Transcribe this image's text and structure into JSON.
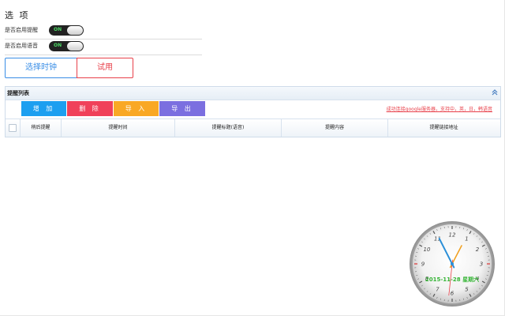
{
  "options": {
    "title": "选 项",
    "rows": [
      {
        "label": "是否启用提醒",
        "state": "ON"
      },
      {
        "label": "是否启用语音",
        "state": "ON"
      }
    ]
  },
  "buttons": {
    "select_clock": "选择时钟",
    "trial": "试用"
  },
  "reminder_list": {
    "title": "提醒列表",
    "toolbar": {
      "add": "增 加",
      "delete": "删 除",
      "import": "导 入",
      "export": "导 出"
    },
    "status_text": "成功连接google服务器，支持中，英，日，韩语音",
    "columns": [
      "稍后提醒",
      "提醒时间",
      "提醒标题(语音)",
      "提醒内容",
      "提醒链接地址"
    ]
  },
  "clock": {
    "date_text": "2015-11-28 星期六",
    "numerals": [
      "12",
      "1",
      "2",
      "3",
      "4",
      "5",
      "6",
      "7",
      "8",
      "9",
      "10",
      "11"
    ],
    "time": {
      "hour": 12,
      "minute": 55,
      "second": 31
    }
  },
  "colors": {
    "blue": "#1c9ff0",
    "red": "#f0415a",
    "orange": "#f9a825",
    "purple": "#7b6fe0",
    "accent_blue": "#3a8ee6",
    "date_green": "#35b535"
  }
}
